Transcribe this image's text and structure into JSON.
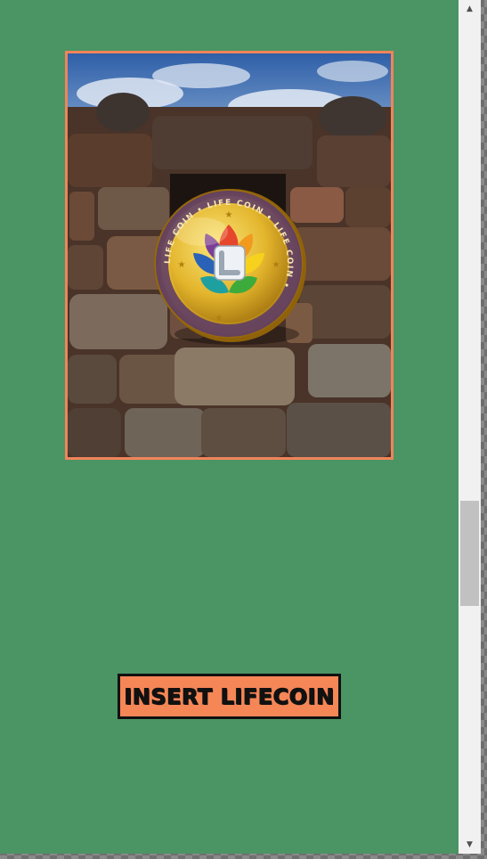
{
  "page": {
    "background_color": "#4b9464"
  },
  "hero_image": {
    "alt": "Life Coin gold coin in front of a stone wall",
    "border_color": "#f0845a",
    "coin_ring_text": "LIFE COIN • LIFE COIN • LIFE COIN •"
  },
  "insert_button": {
    "label": "INSERT LIFECOIN",
    "background": "#f58656"
  },
  "scrollbar": {
    "up_icon": "arrow-up-icon",
    "down_icon": "arrow-down-icon"
  }
}
